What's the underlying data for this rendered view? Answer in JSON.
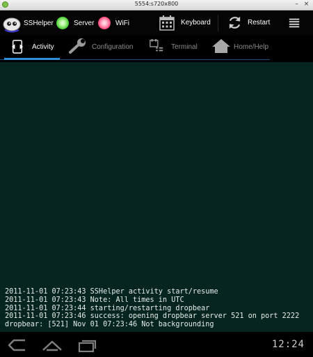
{
  "window": {
    "title": "5554:s720x800",
    "minimize_glyph": "–",
    "close_glyph": "×"
  },
  "actionbar": {
    "app_name": "SSHelper",
    "server_label": "Server",
    "wifi_label": "WiFi",
    "keyboard_label": "Keyboard",
    "restart_label": "Restart",
    "server_color": "#4fd13a",
    "wifi_color": "#ff4f82"
  },
  "tabs": [
    {
      "label": "Activity",
      "icon": "activity-icon",
      "active": true
    },
    {
      "label": "Configuration",
      "icon": "wrench-icon",
      "active": false
    },
    {
      "label": "Terminal",
      "icon": "terminal-icon",
      "active": false
    },
    {
      "label": "Home/Help",
      "icon": "home-icon",
      "active": false
    }
  ],
  "log": {
    "lines": [
      "2011-11-01 07:23:43 SSHelper activity start/resume",
      "2011-11-01 07:23:43 Note: All times in UTC",
      "2011-11-01 07:23:44 starting/restarting dropbear",
      "2011-11-01 07:23:46 success: opening dropbear server 521 on port 2222",
      "dropbear: [521] Nov 01 07:23:46 Not backgrounding"
    ],
    "background_color": "#062521"
  },
  "navbar": {
    "clock_text": "12:24"
  },
  "colors": {
    "accent": "#2f8fd8"
  }
}
